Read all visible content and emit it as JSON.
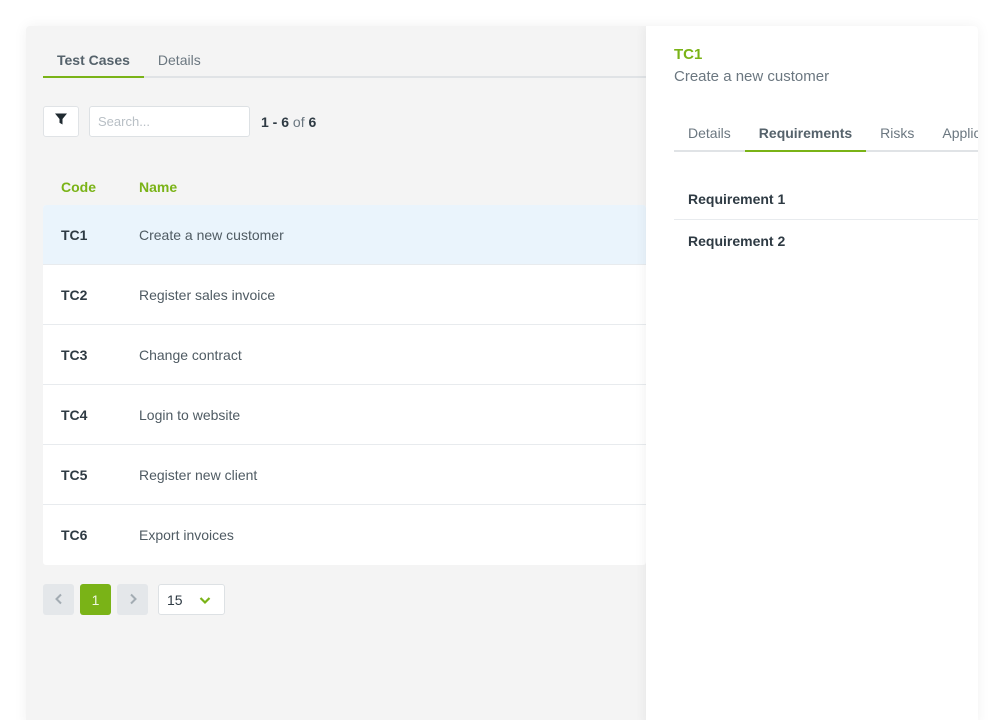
{
  "left": {
    "tabs": [
      {
        "label": "Test Cases",
        "active": true
      },
      {
        "label": "Details",
        "active": false
      }
    ],
    "toolbar": {
      "filter_icon": "filter-icon",
      "search_placeholder": "Search...",
      "search_value": "",
      "count": {
        "range": "1 - 6",
        "of_label": "of",
        "total": "6"
      }
    },
    "table": {
      "columns": [
        "Code",
        "Name"
      ],
      "rows": [
        {
          "code": "TC1",
          "name": "Create a new customer",
          "selected": true
        },
        {
          "code": "TC2",
          "name": "Register sales invoice"
        },
        {
          "code": "TC3",
          "name": "Change contract"
        },
        {
          "code": "TC4",
          "name": "Login to website"
        },
        {
          "code": "TC5",
          "name": "Register new client"
        },
        {
          "code": "TC6",
          "name": "Export invoices"
        }
      ]
    },
    "pagination": {
      "prev_icon": "chevron-left-icon",
      "current_page": "1",
      "next_icon": "chevron-right-icon",
      "page_size": "15",
      "page_size_icon": "chevron-down-icon"
    }
  },
  "panel": {
    "code": "TC1",
    "title": "Create a new customer",
    "tabs": [
      {
        "label": "Details",
        "active": false
      },
      {
        "label": "Requirements",
        "active": true
      },
      {
        "label": "Risks",
        "active": false
      },
      {
        "label": "Applic",
        "active": false
      }
    ],
    "requirements": [
      "Requirement 1",
      "Requirement 2"
    ]
  },
  "colors": {
    "accent": "#7ab317",
    "selected_row": "#eaf4fc",
    "background": "#f4f4f4"
  }
}
